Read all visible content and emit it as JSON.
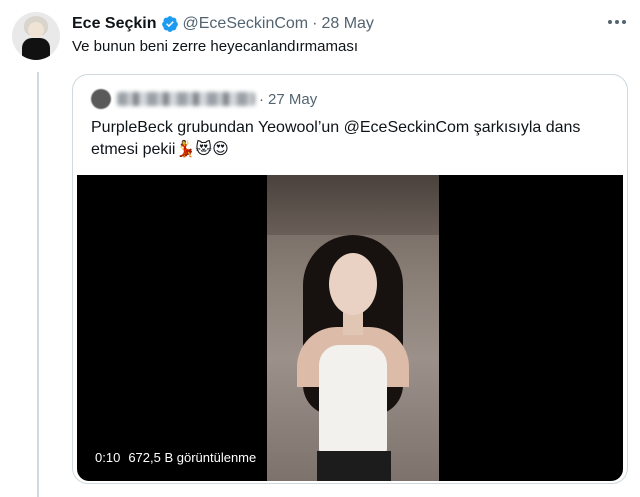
{
  "tweet": {
    "author_name": "Ece Seçkin",
    "handle": "@EceSeckinCom",
    "separator": "·",
    "date": "28 May",
    "text": "Ve bunun beni zerre heyecanlandırmaması"
  },
  "quoted_tweet": {
    "separator": "·",
    "date": "27 May",
    "text": "PurpleBeck grubundan Yeowool’un @EceSeckinCom şarkısıyla dans etmesi pekii💃😻😍",
    "video": {
      "duration": "0:10",
      "views": "672,5 B görüntülenme"
    }
  },
  "colors": {
    "verified": "#1d9bf0",
    "muted_text": "#536471",
    "border": "#cfd9de"
  },
  "icons": {
    "verified": "verified-badge-icon",
    "more": "more-options-icon"
  }
}
